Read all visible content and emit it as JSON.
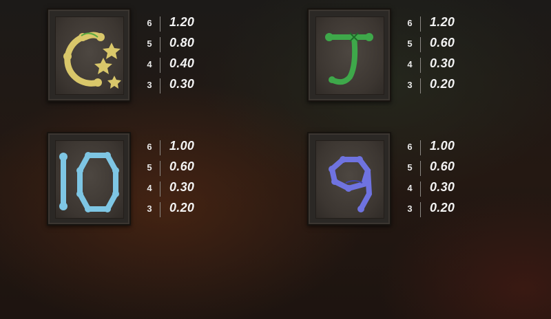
{
  "symbols": [
    {
      "name": "Q",
      "icon": "bone-letter-q-icon",
      "color": "#d9c76a",
      "payouts": [
        {
          "count": "6",
          "amount": "1.20"
        },
        {
          "count": "5",
          "amount": "0.80"
        },
        {
          "count": "4",
          "amount": "0.40"
        },
        {
          "count": "3",
          "amount": "0.30"
        }
      ]
    },
    {
      "name": "J",
      "icon": "bone-letter-j-icon",
      "color": "#3ea84a",
      "payouts": [
        {
          "count": "6",
          "amount": "1.20"
        },
        {
          "count": "5",
          "amount": "0.60"
        },
        {
          "count": "4",
          "amount": "0.30"
        },
        {
          "count": "3",
          "amount": "0.20"
        }
      ]
    },
    {
      "name": "10",
      "icon": "bone-number-10-icon",
      "color": "#7ec6e4",
      "payouts": [
        {
          "count": "6",
          "amount": "1.00"
        },
        {
          "count": "5",
          "amount": "0.60"
        },
        {
          "count": "4",
          "amount": "0.30"
        },
        {
          "count": "3",
          "amount": "0.20"
        }
      ]
    },
    {
      "name": "9",
      "icon": "bone-number-9-icon",
      "color": "#6f73e0",
      "payouts": [
        {
          "count": "6",
          "amount": "1.00"
        },
        {
          "count": "5",
          "amount": "0.60"
        },
        {
          "count": "4",
          "amount": "0.30"
        },
        {
          "count": "3",
          "amount": "0.20"
        }
      ]
    }
  ]
}
